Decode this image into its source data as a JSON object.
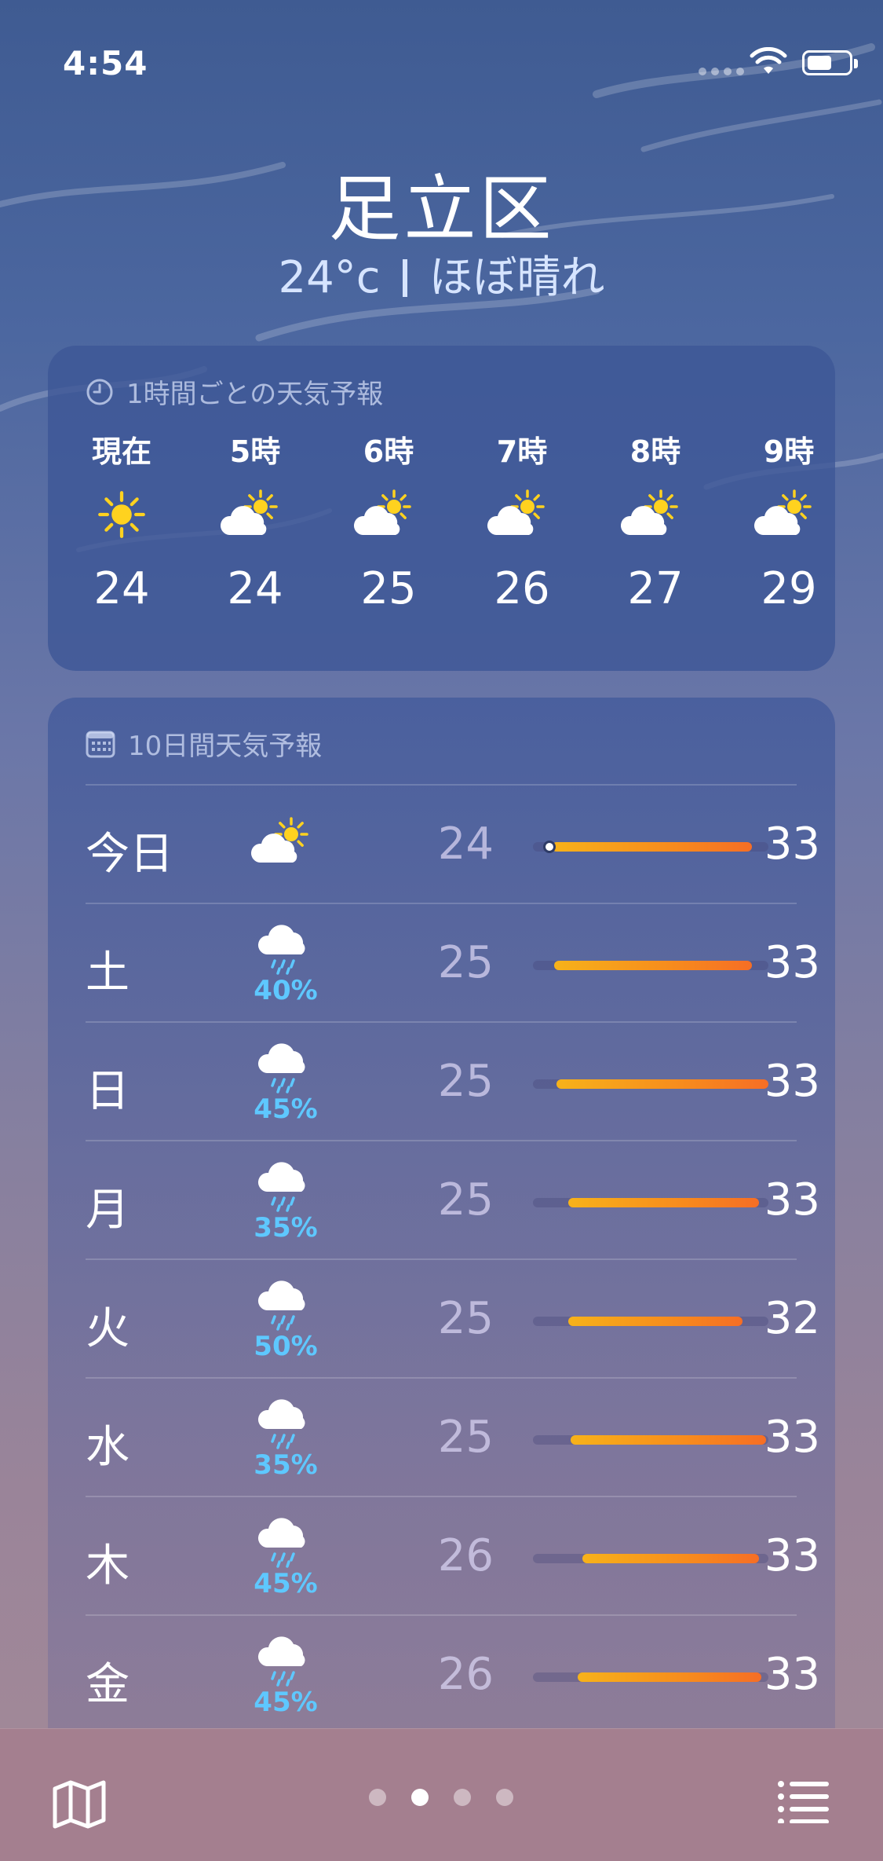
{
  "status_bar": {
    "time": "4:54"
  },
  "location": {
    "city": "足立区",
    "temperature": "24°c",
    "condition": "ほぼ晴れ"
  },
  "hourly": {
    "title": "1時間ごとの天気予報",
    "icon": "clock-icon",
    "items": [
      {
        "label": "現在",
        "icon": "sun-icon",
        "temp": "24"
      },
      {
        "label": "5時",
        "icon": "partly-cloudy-icon",
        "temp": "24"
      },
      {
        "label": "6時",
        "icon": "partly-cloudy-icon",
        "temp": "25"
      },
      {
        "label": "7時",
        "icon": "partly-cloudy-icon",
        "temp": "26"
      },
      {
        "label": "8時",
        "icon": "partly-cloudy-icon",
        "temp": "27"
      },
      {
        "label": "9時",
        "icon": "partly-cloudy-icon",
        "temp": "29"
      }
    ]
  },
  "daily": {
    "title": "10日間天気予報",
    "icon": "calendar-icon",
    "range_min": 24,
    "range_max": 33,
    "days": [
      {
        "name": "今日",
        "icon": "partly-cloudy-icon",
        "precip": "",
        "low": "24",
        "high": "33",
        "bar_start": 0.08,
        "bar_end": 0.93,
        "current": 0.05
      },
      {
        "name": "土",
        "icon": "rain-icon",
        "precip": "40%",
        "low": "25",
        "high": "33",
        "bar_start": 0.09,
        "bar_end": 0.93
      },
      {
        "name": "日",
        "icon": "rain-icon",
        "precip": "45%",
        "low": "25",
        "high": "33",
        "bar_start": 0.1,
        "bar_end": 1.0
      },
      {
        "name": "月",
        "icon": "rain-icon",
        "precip": "35%",
        "low": "25",
        "high": "33",
        "bar_start": 0.15,
        "bar_end": 0.96
      },
      {
        "name": "火",
        "icon": "rain-icon",
        "precip": "50%",
        "low": "25",
        "high": "32",
        "bar_start": 0.15,
        "bar_end": 0.89
      },
      {
        "name": "水",
        "icon": "rain-icon",
        "precip": "35%",
        "low": "25",
        "high": "33",
        "bar_start": 0.16,
        "bar_end": 0.99
      },
      {
        "name": "木",
        "icon": "rain-icon",
        "precip": "45%",
        "low": "26",
        "high": "33",
        "bar_start": 0.21,
        "bar_end": 0.96
      },
      {
        "name": "金",
        "icon": "rain-icon",
        "precip": "45%",
        "low": "26",
        "high": "33",
        "bar_start": 0.19,
        "bar_end": 0.97
      }
    ]
  },
  "bottom_bar": {
    "map_icon": "map-icon",
    "list_icon": "list-icon",
    "page_count": 4,
    "active_page": 1
  },
  "colors": {
    "accent_bar": "#f78b1d",
    "precip": "#5ec8ff",
    "sun": "#ffd21f"
  }
}
